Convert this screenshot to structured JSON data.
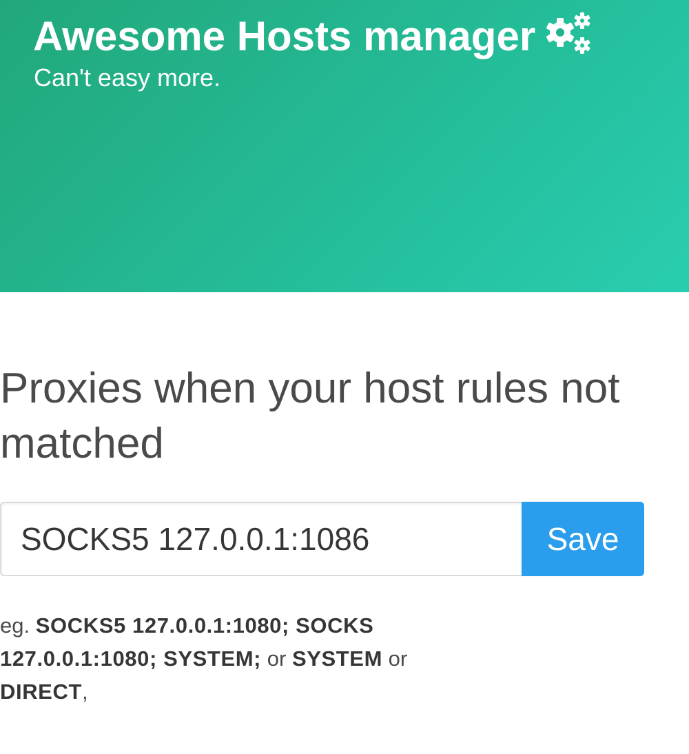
{
  "hero": {
    "title": "Awesome Hosts manager",
    "subtitle": "Can't easy more.",
    "icon": "gears-icon"
  },
  "section": {
    "heading": "Proxies when your host rules not matched"
  },
  "proxy_form": {
    "input_value": "SOCKS5 127.0.0.1:1086",
    "save_label": "Save"
  },
  "help": {
    "prefix": "eg.",
    "example1": "SOCKS5 127.0.0.1:1080; SOCKS 127.0.0.1:1080; SYSTEM;",
    "or1": "or",
    "example2": "SYSTEM",
    "or2": "or",
    "example3": "DIRECT",
    "suffix": ","
  },
  "colors": {
    "hero_gradient_start": "#22a77b",
    "hero_gradient_end": "#29cdb0",
    "button": "#2a9ded"
  }
}
